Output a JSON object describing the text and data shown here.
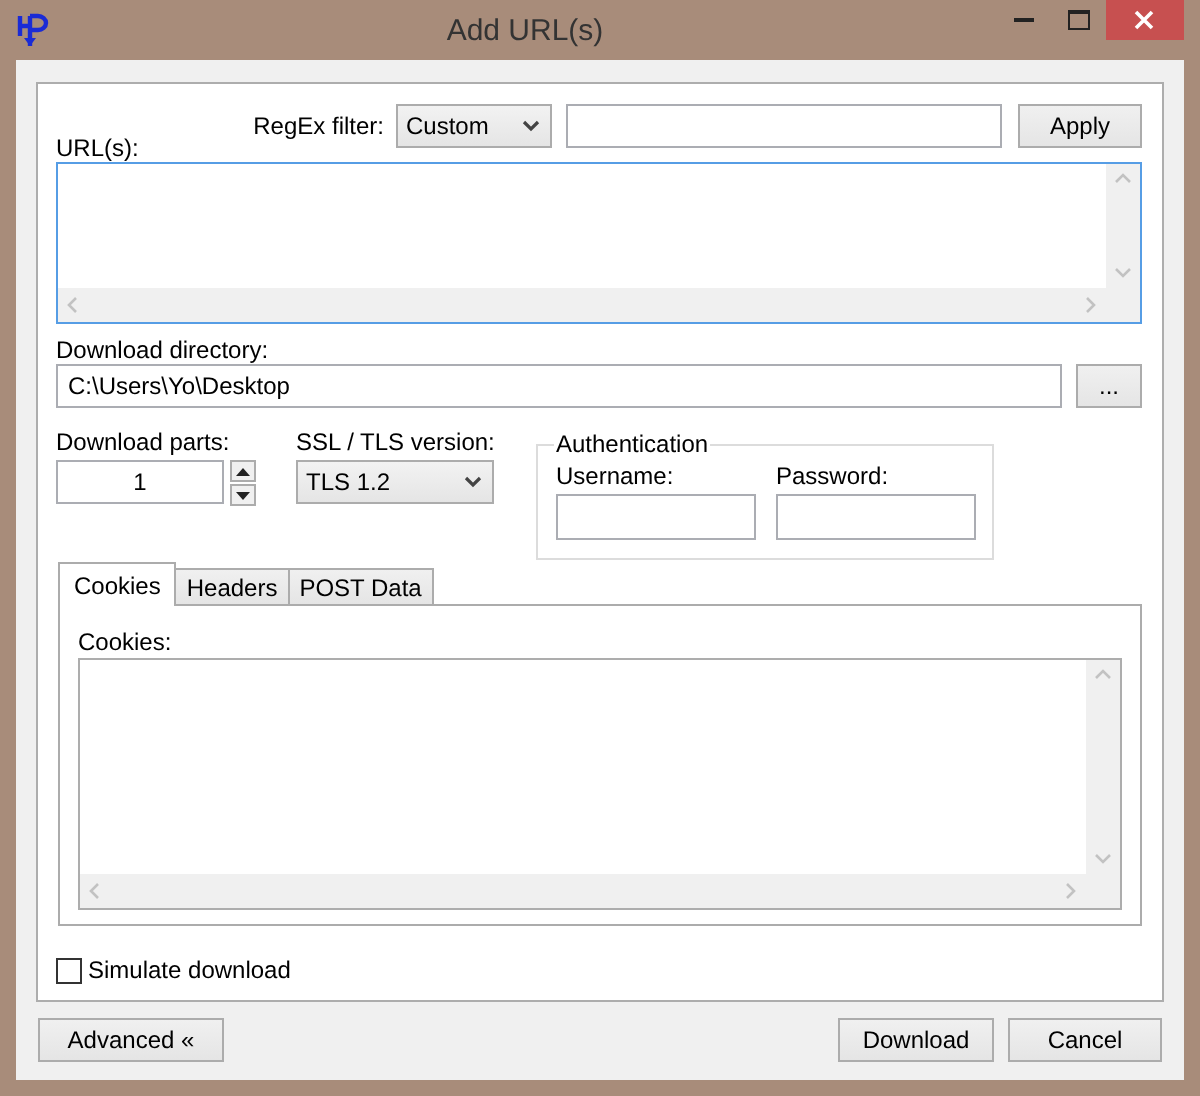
{
  "window": {
    "title": "Add URL(s)"
  },
  "regex_filter": {
    "label": "RegEx filter:",
    "value": "Custom"
  },
  "apply_button": {
    "label": "Apply"
  },
  "urls": {
    "label": "URL(s):",
    "focused": true
  },
  "download_directory": {
    "label": "Download directory:",
    "value": "C:\\Users\\Yo\\Desktop",
    "browse_button": "..."
  },
  "download_parts": {
    "label": "Download parts:",
    "value": "1"
  },
  "ssl_tls": {
    "label": "SSL / TLS version:",
    "value": "TLS 1.2"
  },
  "authentication": {
    "title": "Authentication",
    "username_label": "Username:",
    "password_label": "Password:"
  },
  "tabs": [
    {
      "label": "Cookies",
      "selected": true
    },
    {
      "label": "Headers",
      "selected": false
    },
    {
      "label": "POST Data",
      "selected": false
    }
  ],
  "tab_panel": {
    "label": "Cookies:"
  },
  "simulate_download": {
    "label": "Simulate download",
    "checked": false
  },
  "buttons": [
    {
      "label": "Advanced «",
      "kind": "left"
    },
    {
      "label": "Download",
      "kind": "right"
    },
    {
      "label": "Cancel",
      "kind": "right"
    }
  ]
}
